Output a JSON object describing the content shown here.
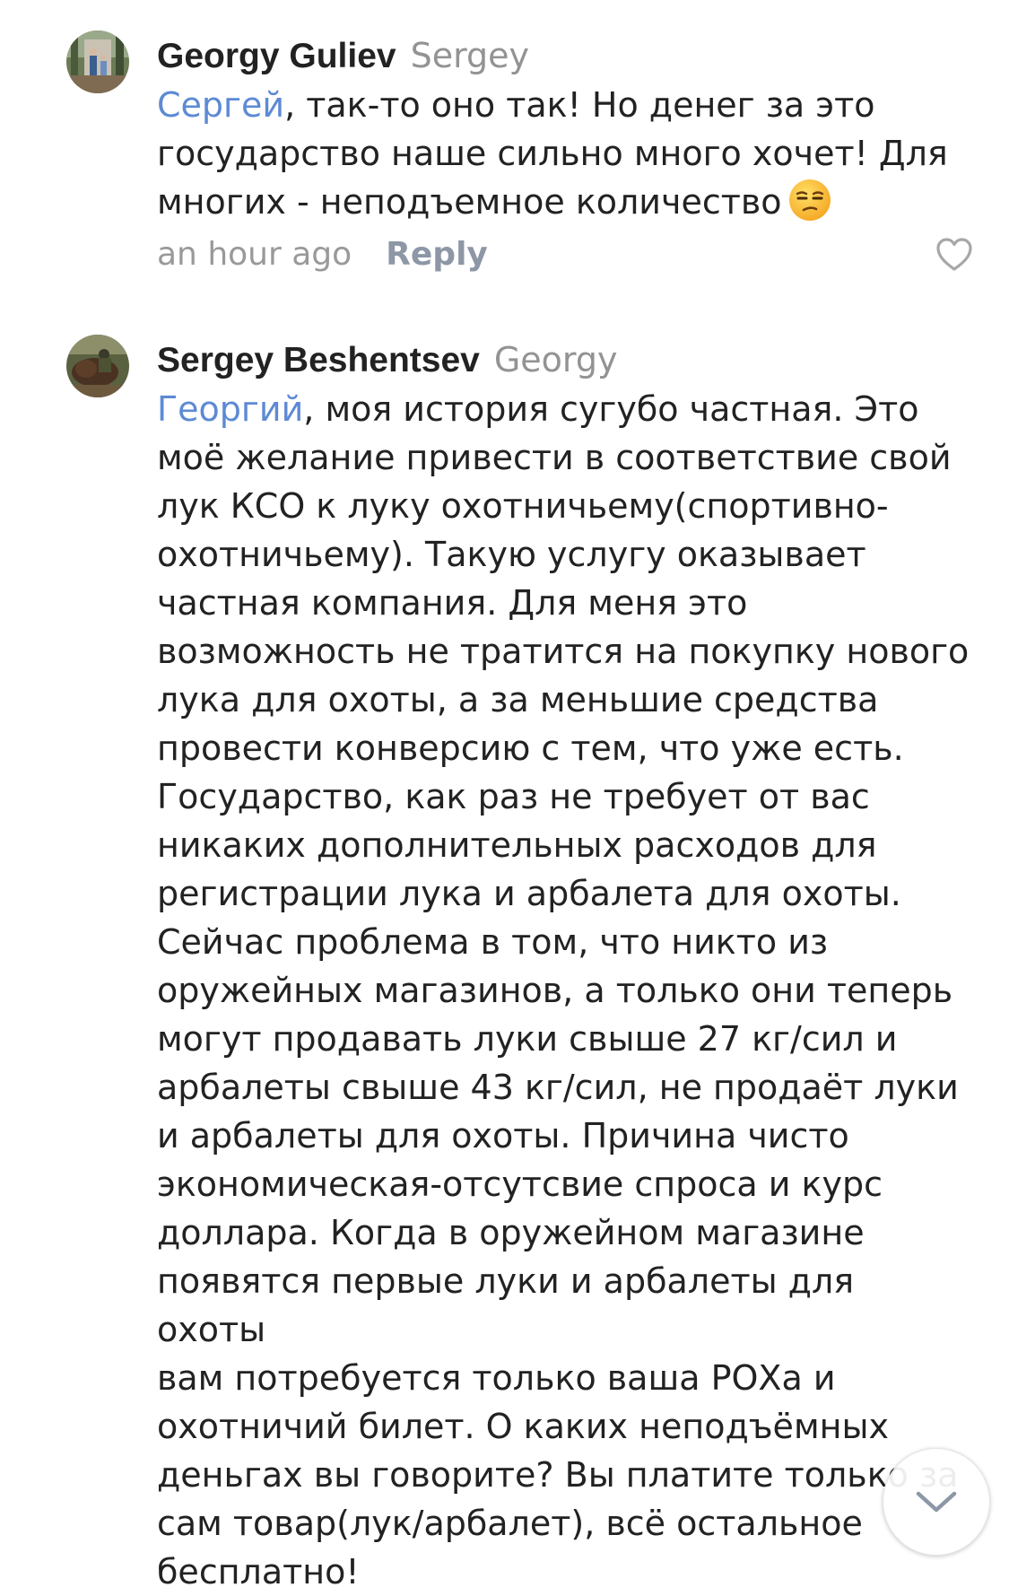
{
  "comments": [
    {
      "author": "Georgy Guliev",
      "reply_to": "Sergey",
      "mention": "Сергей",
      "lines": [
        ", так-то оно так! Но денег за это",
        "государство наше сильно много хочет! Для",
        "многих - неподъемное количество"
      ],
      "emoji_icon": "unamused-face-emoji",
      "time": "an hour ago",
      "reply_label": "Reply",
      "like_icon": "heart-outline-icon"
    },
    {
      "author": "Sergey Beshentsev",
      "reply_to": "Georgy",
      "mention": "Георгий",
      "lines": [
        ", моя история сугубо частная. Это",
        "моё желание привести в соответствие свой",
        "лук КСО к луку охотничьему(спортивно-",
        "охотничьему). Такую услугу оказывает",
        "частная компания. Для меня это",
        "возможность не тратится на покупку нового",
        "лука для охоты, а за меньшие средства",
        "провести конверсию с тем, что уже есть.",
        "Государство, как раз не требует от вас",
        "никаких дополнительных расходов для",
        "регистрации лука и арбалета для охоты.",
        "Сейчас проблема в том, что никто из",
        "оружейных магазинов, а только они теперь",
        "могут продавать луки свыше 27 кг/сил и",
        "арбалеты свыше 43 кг/сил, не продаёт луки",
        "и арбалеты для охоты. Причина чисто",
        "экономическая-отсутсвие спроса и курс",
        "доллара. Когда в оружейном магазине",
        "появятся первые луки и арбалеты для охоты",
        "вам потребуется только ваша РОХа и",
        "охотничий билет. О каких неподъёмных",
        "деньгах вы говорите? Вы платите только за",
        "сам товар(лук/арбалет), всё остальное",
        "бесплатно!"
      ]
    }
  ],
  "scroll_button_icon": "chevron-down-icon",
  "colors": {
    "text": "#222222",
    "muted": "#939393",
    "mention": "#5d8ad4",
    "reply": "#8d97a6"
  }
}
